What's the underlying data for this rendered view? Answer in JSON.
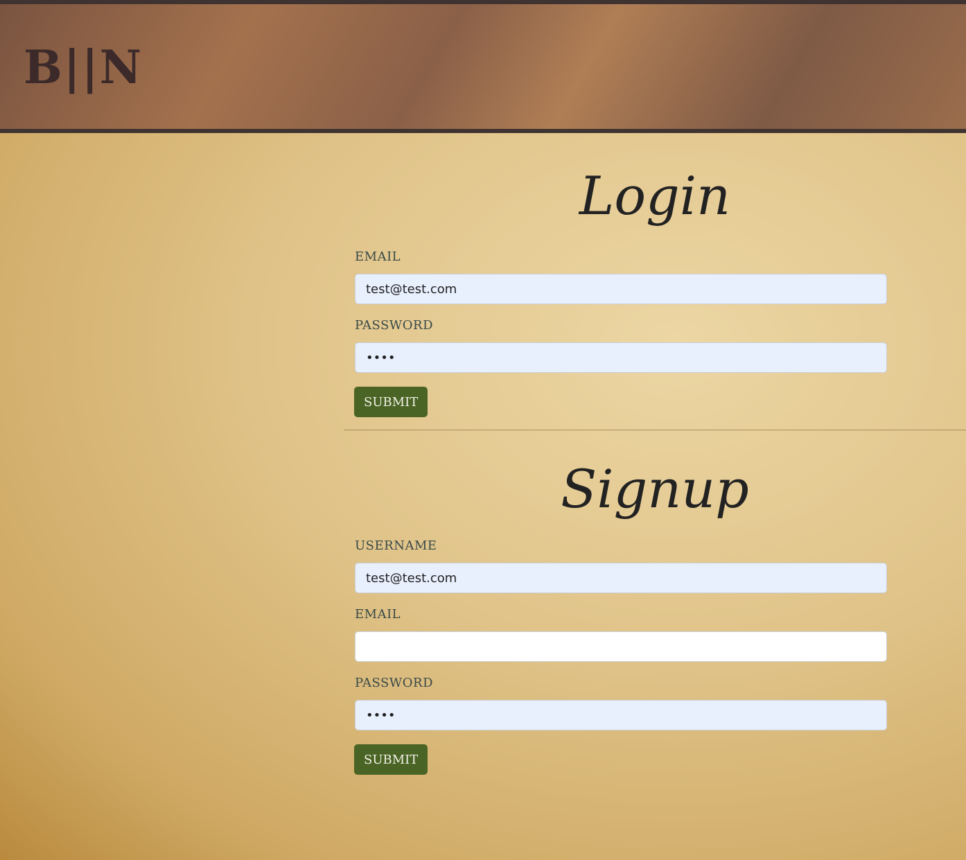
{
  "header": {
    "logo": "B||N"
  },
  "login": {
    "title": "Login",
    "email_label": "EMAIL",
    "email_value": "test@test.com",
    "password_label": "PASSWORD",
    "password_value": "abcd",
    "submit": "SUBMIT"
  },
  "signup": {
    "title": "Signup",
    "username_label": "USERNAME",
    "username_value": "test@test.com",
    "email_label": "EMAIL",
    "email_value": "",
    "password_label": "PASSWORD",
    "password_value": "abcd",
    "submit": "SUBMIT"
  }
}
